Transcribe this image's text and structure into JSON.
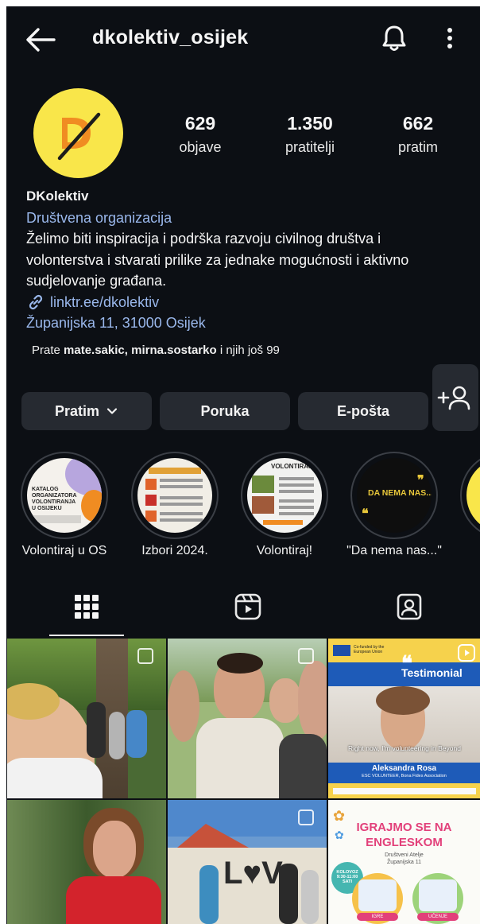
{
  "header": {
    "title": "dkolektiv_osijek",
    "back_icon": "arrow-left-icon",
    "bell_icon": "bell-icon",
    "more_icon": "more-vertical-icon"
  },
  "profile": {
    "avatar_text": "D/",
    "avatar_color": "#f9e64a",
    "stats": [
      {
        "value": "629",
        "label": "objave"
      },
      {
        "value": "1.350",
        "label": "pratitelji"
      },
      {
        "value": "662",
        "label": "pratim"
      }
    ],
    "name": "DKolektiv",
    "category": "Društvena organizacija",
    "bio_lines": [
      "Želimo biti inspiracija i podrška razvoju civilnog društva i",
      "volonterstva i stvarati prilike za jednake mogućnosti i aktivno",
      "sudjelovanje građana."
    ],
    "link": "linktr.ee/dkolektiv",
    "address": "Županijska 11, 31000 Osijek",
    "followed_by": {
      "prefix": "Prate",
      "user1": "mate.sakic",
      "sep": ",",
      "user2": "mirna.sostarko",
      "suffix": "i njih još 99"
    }
  },
  "actions": {
    "following_label": "Pratim",
    "message_label": "Poruka",
    "email_label": "E-pošta",
    "add_user_icon": "add-person-icon"
  },
  "highlights": [
    {
      "label": "Volontiraj u OS",
      "cover_text": "KATALOG ORGANIZATORA VOLONTIRANJA U OSIJEKU"
    },
    {
      "label": "Izbori 2024.",
      "cover_text": ""
    },
    {
      "label": "Volontiraj!",
      "cover_text": "VOLONTIRAJ"
    },
    {
      "label": "\"Da nema nas...\"",
      "cover_text": "DA NEMA NAS..."
    }
  ],
  "tabs": {
    "grid_icon": "grid-icon",
    "reels_icon": "reels-icon",
    "tagged_icon": "tagged-person-icon"
  },
  "posts": {
    "testimonial": {
      "tag": "Testimonial",
      "quote": "Right now, I'm volunteering in Beyond",
      "name": "Aleksandra Rosa",
      "role": "ESC VOLUNTEER, Bona Fides Association",
      "eu": "Co-funded by the European Union"
    },
    "english": {
      "line1": "IGRAJMO SE NA",
      "line2": "ENGLESKOM",
      "venue1": "Društveni Atelje",
      "venue2": "Županijska 11",
      "sticker": "KOLOVOZ 9:30-11:00 SATI",
      "tag1": "IGRE",
      "tag2": "UČENJE"
    },
    "street_sign": "L♥Ve"
  }
}
